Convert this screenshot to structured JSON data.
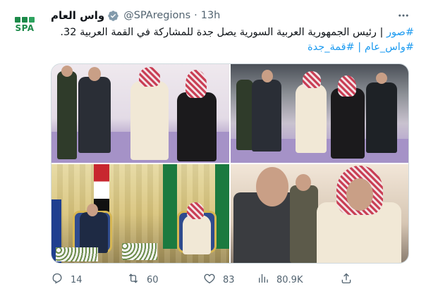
{
  "account": {
    "display_name": "واس العام",
    "handle": "@SPAregions",
    "time": "13h",
    "avatar_logo_text": "SPA"
  },
  "tweet": {
    "line1_hashtag": "#صور",
    "line1_text": " | رئيس الجمهورية العربية السورية يصل جدة للمشاركة في القمة العربية 32.",
    "line2_hashtag1": "#واس_عام",
    "line2_sep": " | ",
    "line2_hashtag2": "#قمة_جدة"
  },
  "media": {
    "photos": [
      {
        "name": "arrival-photo-1"
      },
      {
        "name": "arrival-photo-2"
      },
      {
        "name": "meeting-photo"
      },
      {
        "name": "closeup-photo"
      }
    ]
  },
  "actions": {
    "replies": "14",
    "retweets": "60",
    "likes": "83",
    "views": "80.9K"
  },
  "colors": {
    "accent": "#1d9bf0",
    "secondary_text": "#536471",
    "verified": "#829aab",
    "spa_green": "#1d8a4a"
  },
  "icons": [
    "verified-badge-icon",
    "more-icon",
    "reply-icon",
    "retweet-icon",
    "like-icon",
    "views-icon",
    "share-icon"
  ]
}
